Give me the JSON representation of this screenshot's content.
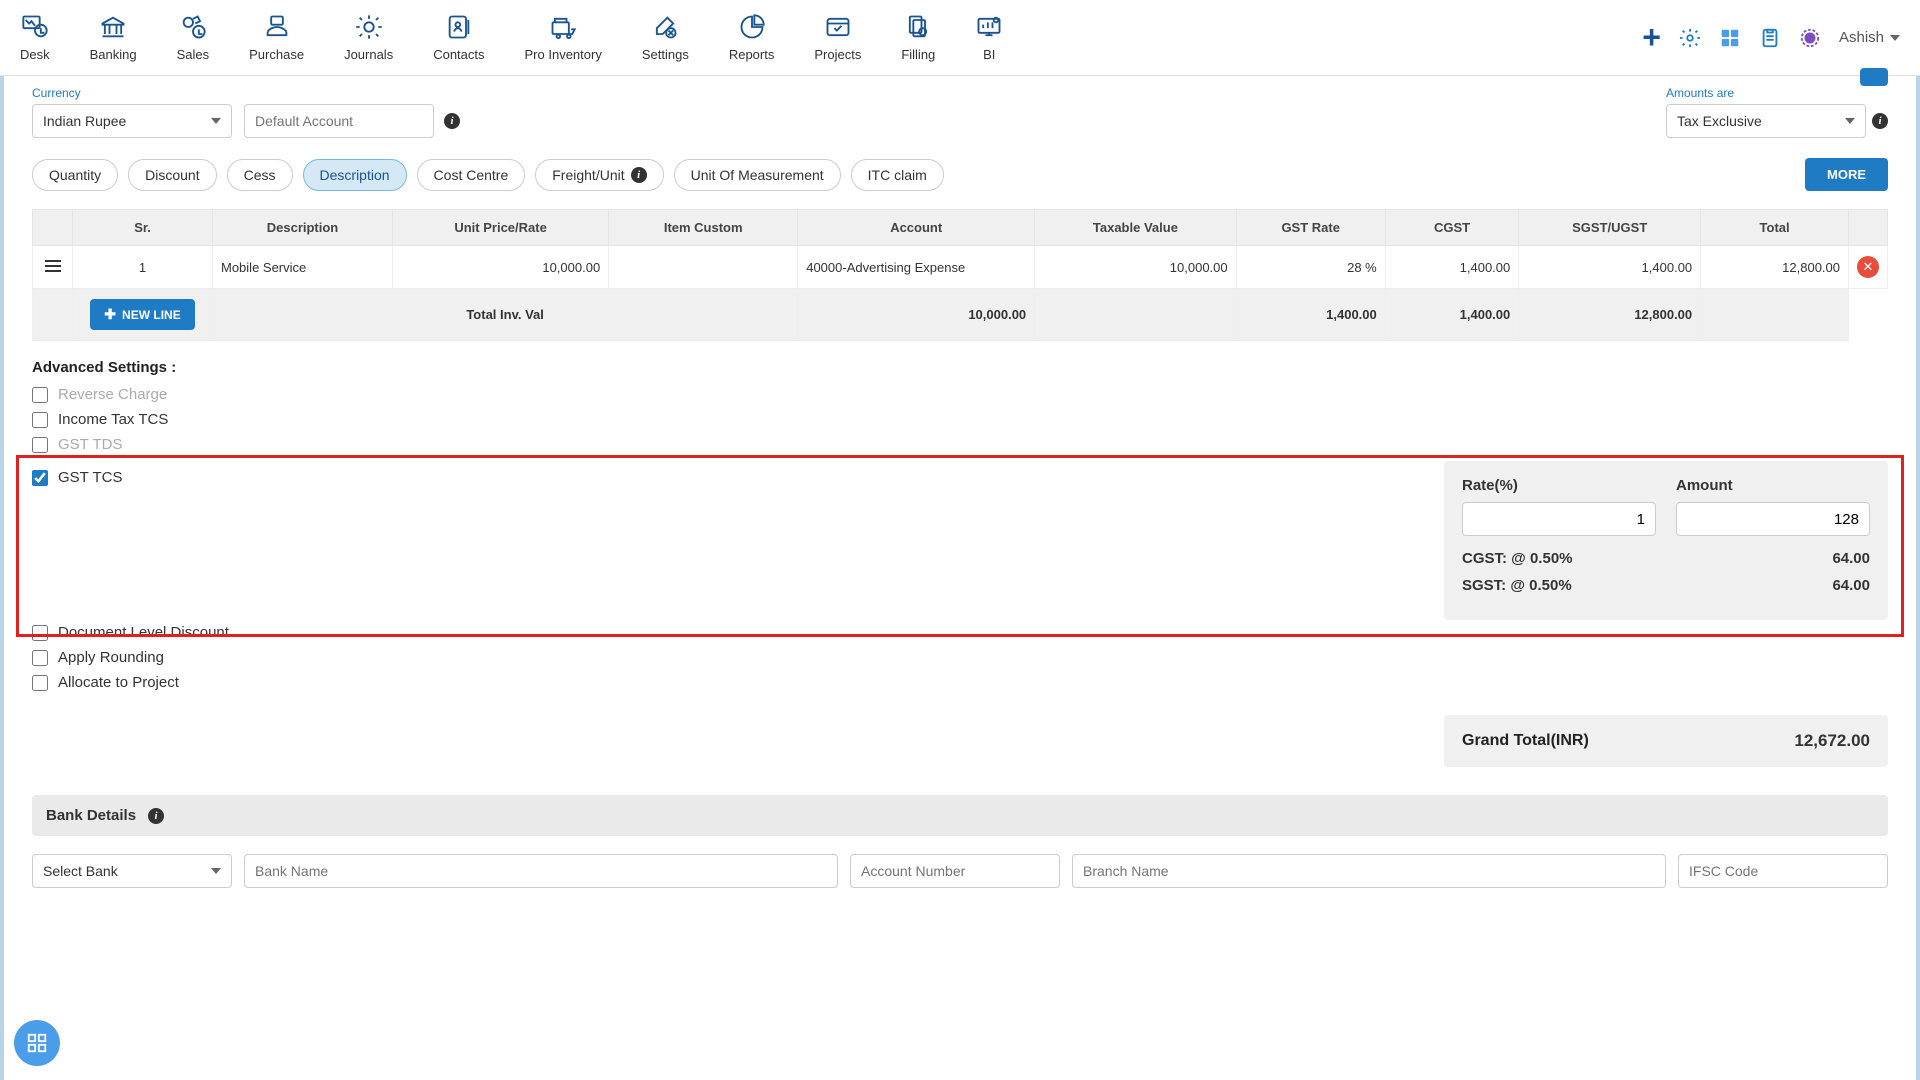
{
  "nav": [
    {
      "label": "Desk"
    },
    {
      "label": "Banking"
    },
    {
      "label": "Sales"
    },
    {
      "label": "Purchase"
    },
    {
      "label": "Journals"
    },
    {
      "label": "Contacts"
    },
    {
      "label": "Pro Inventory"
    },
    {
      "label": "Settings"
    },
    {
      "label": "Reports"
    },
    {
      "label": "Projects"
    },
    {
      "label": "Filling"
    },
    {
      "label": "BI"
    }
  ],
  "user_name": "Ashish",
  "currency": {
    "label": "Currency",
    "value": "Indian Rupee"
  },
  "default_account": {
    "placeholder": "Default Account"
  },
  "amounts": {
    "label": "Amounts are",
    "value": "Tax Exclusive"
  },
  "chips": [
    "Quantity",
    "Discount",
    "Cess",
    "Description",
    "Cost Centre",
    "Freight/Unit",
    "Unit Of Measurement",
    "ITC claim"
  ],
  "chip_active": 3,
  "more_label": "MORE",
  "table": {
    "headers": [
      "Sr.",
      "Description",
      "Unit Price/Rate",
      "Item Custom",
      "Account",
      "Taxable Value",
      "GST Rate",
      "CGST",
      "SGST/UGST",
      "Total"
    ],
    "row": {
      "sr": "1",
      "desc": "Mobile Service",
      "unit_price": "10,000.00",
      "item_custom": "",
      "account": "40000-Advertising Expense",
      "taxable": "10,000.00",
      "gst_rate": "28 %",
      "cgst": "1,400.00",
      "sgst": "1,400.00",
      "total": "12,800.00"
    },
    "totals": {
      "label": "Total Inv. Val",
      "taxable": "10,000.00",
      "cgst": "1,400.00",
      "sgst": "1,400.00",
      "total": "12,800.00"
    },
    "new_line": "NEW LINE"
  },
  "advanced": {
    "title": "Advanced Settings :",
    "options": [
      {
        "label": "Reverse Charge",
        "checked": false,
        "disabled": true
      },
      {
        "label": "Income Tax TCS",
        "checked": false,
        "disabled": false
      },
      {
        "label": "GST TDS",
        "checked": false,
        "disabled": true
      },
      {
        "label": "GST TCS",
        "checked": true,
        "disabled": false
      },
      {
        "label": "Document Level Discount",
        "checked": false,
        "disabled": false
      },
      {
        "label": "Apply Rounding",
        "checked": false,
        "disabled": false
      },
      {
        "label": "Allocate to Project",
        "checked": false,
        "disabled": false
      }
    ]
  },
  "tcs": {
    "rate_label": "Rate(%)",
    "rate_value": "1",
    "amount_label": "Amount",
    "amount_value": "128",
    "cgst_label": "CGST: @ 0.50%",
    "cgst_value": "64.00",
    "sgst_label": "SGST: @ 0.50%",
    "sgst_value": "64.00"
  },
  "grand_total": {
    "label": "Grand Total(INR)",
    "value": "12,672.00"
  },
  "bank": {
    "title": "Bank Details",
    "select_placeholder": "Select Bank",
    "name_placeholder": "Bank Name",
    "account_placeholder": "Account Number",
    "branch_placeholder": "Branch Name",
    "ifsc_placeholder": "IFSC Code"
  }
}
